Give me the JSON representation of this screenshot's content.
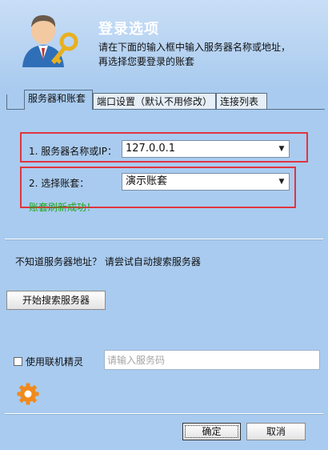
{
  "header": {
    "title": "登录选项",
    "desc_line1": "请在下面的输入框中输入服务器名称或地址，",
    "desc_line2": "再选择您要登录的账套"
  },
  "tabs": [
    {
      "label": "服务器和账套",
      "active": true
    },
    {
      "label": "端口设置（默认不用修改）",
      "active": false
    },
    {
      "label": "连接列表",
      "active": false
    }
  ],
  "server": {
    "label": "1. 服务器名称或IP：",
    "value": "127.0.0.1"
  },
  "account": {
    "label": "2. 选择账套：",
    "value": "演示账套"
  },
  "status_message": "账套刷新成功！",
  "search": {
    "hint": "不知道服务器地址？ 请尝试自动搜索服务器",
    "button_label": "开始搜索服务器"
  },
  "remote_assist": {
    "checkbox_label": "使用联机精灵",
    "placeholder": "请输入服务码",
    "checked": false
  },
  "footer": {
    "ok_label": "确定",
    "cancel_label": "取消"
  },
  "colors": {
    "background": "#a9cbef",
    "highlight_border": "#e0353f",
    "success_text": "#1aa61a",
    "gear": "#f08a1c"
  }
}
